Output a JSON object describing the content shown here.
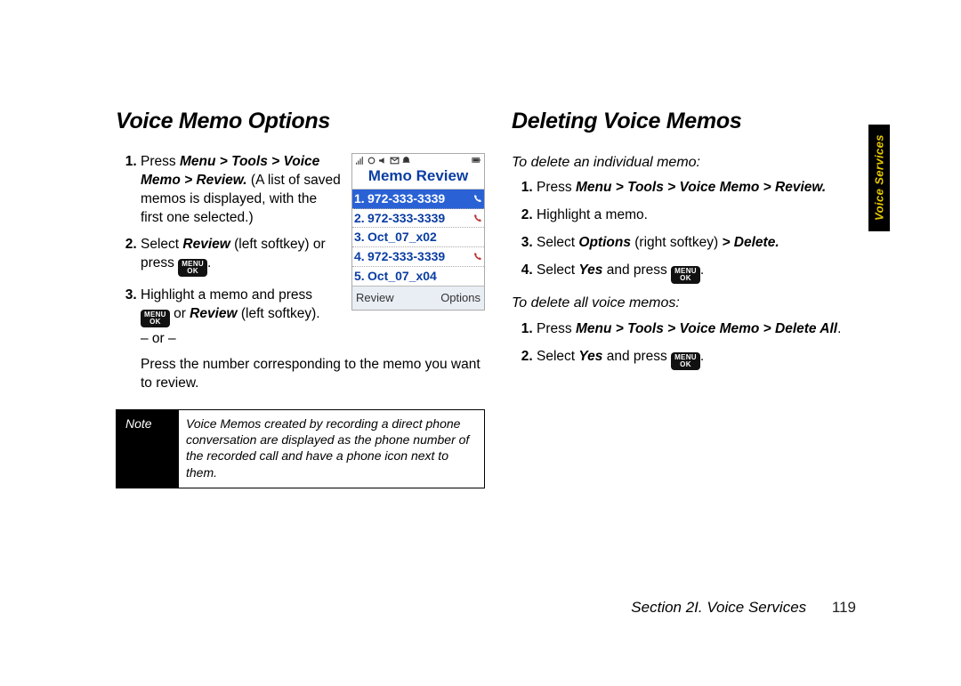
{
  "sideTab": "Voice Services",
  "footer": {
    "section": "Section 2I. Voice Services",
    "page": "119"
  },
  "keycap": {
    "top": "MENU",
    "bottom": "OK"
  },
  "left": {
    "heading": "Voice Memo Options",
    "step1": {
      "pre": "Press ",
      "path": "Menu > Tools > Voice Memo > Review.",
      "post": " (A list of saved memos is displayed, with the first one selected.)"
    },
    "step2": {
      "a": "Select ",
      "b": "Review",
      "c": " (left softkey) or press ",
      "end": "."
    },
    "step3": {
      "a": "Highlight a memo and press ",
      "b": " or ",
      "c": "Review",
      "d": " (left softkey)."
    },
    "or": "– or –",
    "orPress": "Press the number corresponding to the memo you want to review.",
    "note": {
      "label": "Note",
      "text": "Voice Memos created by recording a direct phone conversation are displayed as the phone number of the recorded call and have a phone icon next to them."
    }
  },
  "right": {
    "heading": "Deleting Voice Memos",
    "sub1": "To delete an individual memo:",
    "i1": {
      "a": "Press ",
      "b": "Menu > Tools > Voice Memo > Review.",
      "c": ""
    },
    "i2": "Highlight a memo.",
    "i3": {
      "a": "Select ",
      "b": "Options",
      "c": " (right softkey) ",
      "d": "> Delete.",
      "e": ""
    },
    "i4": {
      "a": "Select ",
      "b": "Yes",
      "c": " and press ",
      "end": "."
    },
    "sub2": "To delete all voice memos:",
    "a1": {
      "a": "Press ",
      "b": "Menu > Tools > Voice Memo > Delete All",
      "c": "."
    },
    "a2": {
      "a": "Select ",
      "b": "Yes",
      "c": " and press ",
      "end": "."
    }
  },
  "phone": {
    "title": "Memo Review",
    "rows": [
      {
        "n": "1.",
        "t": "972-333-3339",
        "phone": true
      },
      {
        "n": "2.",
        "t": "972-333-3339",
        "phone": true
      },
      {
        "n": "3.",
        "t": "Oct_07_x02",
        "phone": false
      },
      {
        "n": "4.",
        "t": "972-333-3339",
        "phone": true
      },
      {
        "n": "5.",
        "t": "Oct_07_x04",
        "phone": false
      }
    ],
    "softLeft": "Review",
    "softRight": "Options"
  }
}
